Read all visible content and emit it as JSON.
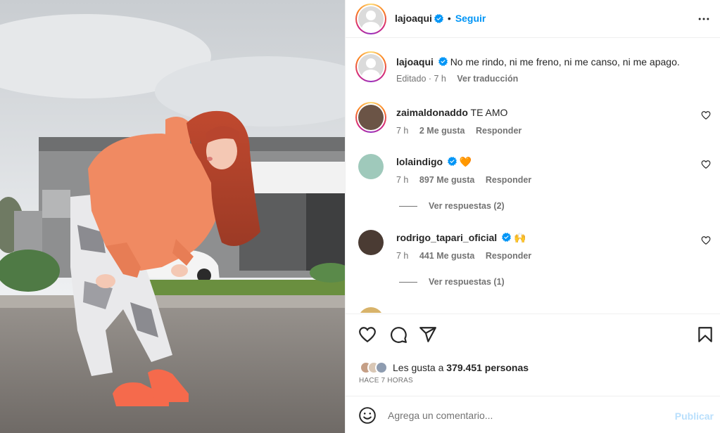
{
  "header": {
    "username": "lajoaqui",
    "separator": "•",
    "follow_label": "Seguir",
    "more_icon": "more-horizontal-icon"
  },
  "caption": {
    "username": "lajoaqui",
    "text": "No me rindo, ni me freno, ni me canso, ni me apago.",
    "edited": "Editado · 7 h",
    "translate": "Ver traducción"
  },
  "comments": [
    {
      "username": "zaimaldonaddo",
      "text": "TE AMO",
      "time": "7 h",
      "likes": "2 Me gusta",
      "reply": "Responder"
    },
    {
      "username": "lolaindigo",
      "text": "🧡",
      "time": "7 h",
      "likes": "897 Me gusta",
      "reply": "Responder",
      "replies": "Ver respuestas (2)"
    },
    {
      "username": "rodrigo_tapari_oficial",
      "text": "🙌",
      "time": "7 h",
      "likes": "441 Me gusta",
      "reply": "Responder",
      "replies": "Ver respuestas (1)"
    }
  ],
  "likes": {
    "prefix": "Les gusta a",
    "count": "379.451 personas"
  },
  "timestamp": "HACE 7 HORAS",
  "comment_box": {
    "placeholder": "Agrega un comentario...",
    "publish": "Publicar"
  },
  "colors": {
    "accent": "#0095f6",
    "publish_disabled": "#b9dffc",
    "hoodie": "#f08a62",
    "hair": "#b8452e",
    "shoes": "#f56a4c"
  }
}
